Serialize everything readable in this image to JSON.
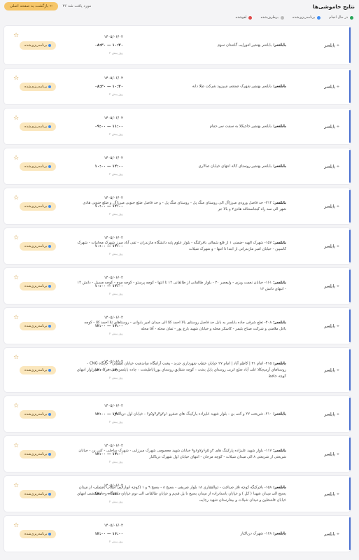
{
  "header": {
    "title": "نتایج خاموشی‌ها",
    "back_label": "بازگشت به صفحه اصلی ←",
    "count_text": "۳۶ مورد یافت شد"
  },
  "legend": [
    {
      "label": "در حال انجام",
      "color": "#2ba65a"
    },
    {
      "label": "برنامه‌ریزی‌شده",
      "color": "#3f8cf3"
    },
    {
      "label": "برطرف‌شده",
      "color": "#bbbbbb"
    },
    {
      "label": "لغو‌شده",
      "color": "#e04a4a"
    }
  ],
  "accent_color": "#4a6fd1",
  "cards": [
    {
      "city": "بابلسر",
      "prefix": "بابلسر:",
      "desc": "بابلسر بهنمیر امورایی گلستان سوم",
      "date": "۱۴۰۵/۰۶/۰۲",
      "range": "۰۸:۳۰ — ۱۰:۳۰",
      "ago": "۲ روز پیش",
      "status": "برنامه‌ریزی‌شده",
      "height": 55
    },
    {
      "city": "بابلسر",
      "prefix": "بابلسر:",
      "desc": "بابلسر بهنمیر شهرک صنعتی میرزود شرکت طلا دانه",
      "date": "۱۴۰۵/۰۶/۰۲",
      "range": "۰۸:۳۰ — ۱۰:۳۰",
      "ago": "۲ روز پیش",
      "status": "برنامه‌ریزی‌شده",
      "height": 51
    },
    {
      "city": "بابلسر",
      "prefix": "بابلسر:",
      "desc": "بابلسر بهنمیر خاجیکلا به سمت سر حمام",
      "date": "۱۴۰۵/۰۶/۰۲",
      "range": "۰۹:۰۰ — ۱۱:۰۰",
      "ago": "۲ روز پیش",
      "status": "برنامه‌ریزی‌شده",
      "height": 51
    },
    {
      "city": "بابلسر",
      "prefix": "بابلسر:",
      "desc": "بابلسر بهنمیر روستای کاله انتهای خیابان صالاری",
      "date": "۱۴۰۵/۰۶/۰۲",
      "range": "۱۰:۰۰ — ۱۲:۰۰",
      "ago": "۲ روز پیش",
      "status": "برنامه‌ریزی‌شده",
      "height": 51
    },
    {
      "city": "بابلسر",
      "prefix": "بابلسر:",
      "desc": "۳۱۴- حد فاصل ورودی میرزاآل الی روستای منگ پل - روستای منگ پل - و حد فاصل ضلع جنوبی میرزاآل و ضلع جنوبی هادی شهر الی سه راه کیجاسحاقه هادی۲ و بالا جر",
      "date": "۱۴۰۵/۰۶/۰۲",
      "range": "۱۰:۰۰ — ۱۲:۰۰",
      "ago": "۲ روز پیش",
      "status": "برنامه‌ریزی‌شده",
      "height": 51
    },
    {
      "city": "بابلسر",
      "prefix": "بابلسر:",
      "desc": "۱۵۷- شهرک الهیه -ضمنی ۱ از قلع شمالی بافرکنگه - بلوار علوم پایه دانشگاه مازندران - تقی آباد میرز شهرک محابیات - شهرک کاسپین - خیابان امیر مازندرانی از ابتدا تا انتها - و شهرک شیلات",
      "date": "۱۴۰۵/۰۶/۰۲",
      "range": "۱۰:۰۰ — ۱۲:۰۰",
      "ago": "۲ روز پیش",
      "status": "برنامه‌ریزی‌شده",
      "height": 51
    },
    {
      "city": "بابلسر",
      "prefix": "بابلسر:",
      "desc": "۱۶۱- خیابان نعمت ویزی - ولیعصر ۳۰ - بلوار طالقانی از طالقانی ۱۲ تا انتها - کوچه پرستو - کوچه موج - کوچه مسیل - دانش ۱۴ - انتهای دانش ۱۶",
      "date": "۱۴۰۵/۰۶/۰۲",
      "range": "۱۰:۰۰ — ۱۲:۰۰",
      "ago": "۲ روز پیش",
      "status": "برنامه‌ریزی‌شده",
      "height": 51
    },
    {
      "city": "بابلسر",
      "prefix": "بابلسر:",
      "desc": "۴۰۸- تعلع شرقی جاده بابلسر به بابل حد فاصل روستای بالا احمد کلا الی میدان امیر بابوانی - روستاهای تلا احمد کلا - کوچه باغل ملامنی و شرکت صناح بلیمر - کاسکر محله و خیابان شهید بارع پور - تمان محله - آقا محله",
      "date": "۱۴۰۵/۰۶/۰۲",
      "range": "۱۲:۰۰ — ۱۴:۰۰",
      "ago": "۲ روز پیش",
      "status": "برنامه‌ریزی‌شده",
      "height": 51
    },
    {
      "city": "بابلسر",
      "prefix": "بابلسر:",
      "desc": "۴۱۵- امام ۳۱ | کاظم آباد | امام ۲۷ خیابان خطب شهرداری جدید - پشت آرامگاه میاندشت خیابان لطفیان - جایگاه CNG - روستاهای آرمیجکلا علی آباد ضلع غربی روستای بابل بشت - کوچه شقایق روستای پورباباطیشت - جاده بابلسر جنب فرکا - سیزاوار انتهای کوچه حافظ",
      "date": "۱۴۰۵/۰۶/۰۲",
      "range": "۱۲:۰۰ — ۱۴:۰۰",
      "ago": "۲ روز پیش",
      "status": "برنامه‌ریزی‌شده",
      "height": 63
    },
    {
      "city": "بابلسر",
      "prefix": "بابلسر:",
      "desc": "۲۱۰- شریعتی ۲۷ و کنی بن - بلوار شهید علیزاده پارکینگ های صفرو ۱و۲و۳و۴و۵و۶ - خیابان اول دریاکنار",
      "date": "۱۴۰۵/۰۶/۰۲",
      "range": "۱۲:۰۰ — ۱۴:۰۰",
      "ago": "۲ روز پیش",
      "status": "برنامه‌ریزی‌شده",
      "height": 51
    },
    {
      "city": "بابلسر",
      "prefix": "بابلسر:",
      "desc": "۱۱۷- بلوار شهید علیزاده پارکینگ های ۴و ۵و۶و۷و۸و۹ خیابان شهید معصومی شهرک میرزایی - شهرک ساحلی - کنی بن - خیابان شریعتی از شریعتی ۸ الی میدان شیلات - کوچه مرجان - انتهای خیابان اول شهرک دریاکنار",
      "date": "۱۴۰۵/۰۶/۰۲",
      "range": "۱۲:۰۰ — ۱۴:۰۰",
      "ago": "۲ روز پیش",
      "status": "برنامه‌ریزی‌شده",
      "height": 51
    },
    {
      "city": "بابلسر",
      "prefix": "بابلسر:",
      "desc": "۱۵۸- بافرکنگه کوچه تلار صداقت - ذوالفقاری ۱۸ بلوار شریفی - بسیج ۸ - بسیج ۹ و ۱ (کوچه انوارالیی انقلاب )مصلی- از میدان بسیج الی میدان شهدا ( کل ) و خیابان باستانزاده از میدان بسیج تا پل قدیم و خیابان طالقانی الی دوم خیابان دانشگاه و دانشکشتی انتهای خیابان فلسطین و میدان شیلات و بیمارستان شهید رجایی",
      "date": "۱۴۰۵/۰۶/۰۲",
      "range": "۱۴:۰۰ — ۱۶:۰۰",
      "ago": "۲ روز پیش",
      "status": "برنامه‌ریزی‌شده",
      "height": 51
    },
    {
      "city": "بابلسر",
      "prefix": "بابلسر:",
      "desc": "۱۶۸- شهرک دریاکنار",
      "date": "۱۴۰۵/۰۶/۰۲",
      "range": "۱۴:۰۰ — ۱۶:۰۰",
      "ago": "۲ روز پیش",
      "status": "برنامه‌ریزی‌شده",
      "height": 51
    }
  ]
}
